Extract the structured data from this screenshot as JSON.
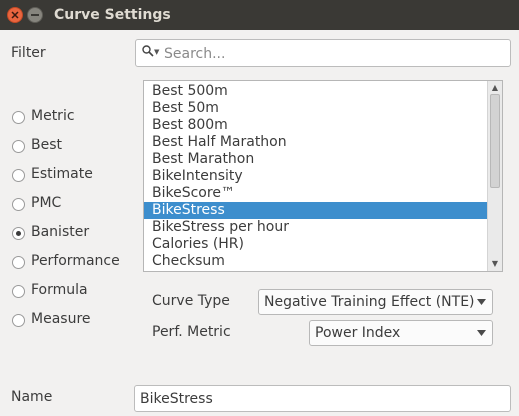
{
  "window": {
    "title": "Curve Settings"
  },
  "filter": {
    "label": "Filter",
    "placeholder": "Search..."
  },
  "icons": {
    "close": "close-icon",
    "minimize": "minimize-icon",
    "search": "search-icon",
    "dropdown": "chevron-down-icon"
  },
  "colors": {
    "selection": "#3d8ecd",
    "titlebar": "#3a3935",
    "close_button": "#e9653f"
  },
  "radios": [
    {
      "label": "Metric",
      "checked": false
    },
    {
      "label": "Best",
      "checked": false
    },
    {
      "label": "Estimate",
      "checked": false
    },
    {
      "label": "PMC",
      "checked": false
    },
    {
      "label": "Banister",
      "checked": true
    },
    {
      "label": "Performance",
      "checked": false
    },
    {
      "label": "Formula",
      "checked": false
    },
    {
      "label": "Measure",
      "checked": false
    }
  ],
  "list": {
    "items": [
      "Best 500m",
      "Best 50m",
      "Best 800m",
      "Best Half Marathon",
      "Best Marathon",
      "BikeIntensity",
      "BikeScore™",
      "BikeStress",
      "BikeStress per hour",
      "Calories (HR)",
      "Checksum"
    ],
    "selected": "BikeStress"
  },
  "curve_type": {
    "label": "Curve Type",
    "value": "Negative Training Effect (NTE)"
  },
  "perf_metric": {
    "label": "Perf. Metric",
    "value": "Power Index"
  },
  "name": {
    "label": "Name",
    "value": "BikeStress"
  }
}
